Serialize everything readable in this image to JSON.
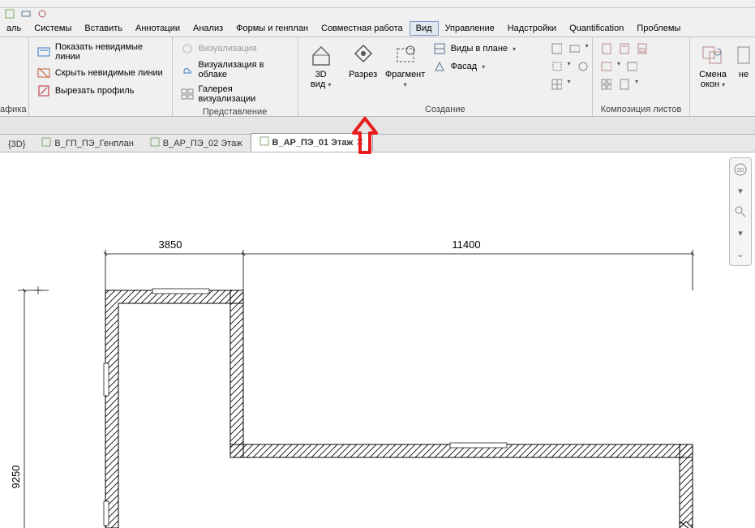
{
  "menu": {
    "items": [
      "аль",
      "Системы",
      "Вставить",
      "Аннотации",
      "Анализ",
      "Формы и генплан",
      "Совместная работа",
      "Вид",
      "Управление",
      "Надстройки",
      "Quantification",
      "Проблемы"
    ]
  },
  "ribbon": {
    "panel1": {
      "items": [
        "Показать невидимые линии",
        "Скрыть невидимые линии",
        "Вырезать профиль"
      ],
      "label": "афика"
    },
    "panel2": {
      "items_disabled": [
        "Визуализация"
      ],
      "items": [
        "Визуализация  в облаке",
        "Галерея  визуализации"
      ],
      "label": "Представление"
    },
    "panel3": {
      "btn3d_l1": "3D",
      "btn3d_l2": "вид",
      "btn_section": "Разрез",
      "btn_callout": "Фрагмент",
      "plan_views": "Виды в плане",
      "elevation": "Фасад",
      "label": "Создание"
    },
    "panel4": {
      "label": "Композиция листов"
    },
    "panel5": {
      "l1": "Смена",
      "l2": "окон",
      "l3": "не"
    }
  },
  "left_label": "афика",
  "tabs": {
    "t0": "{3D}",
    "t1": "В_ГП_ПЭ_Генплан",
    "t2": "В_АР_ПЭ_02 Этаж",
    "t3": "В_АР_ПЭ_01 Этаж"
  },
  "dims": {
    "d1": "3850",
    "d2": "11400",
    "d3": "9250"
  }
}
